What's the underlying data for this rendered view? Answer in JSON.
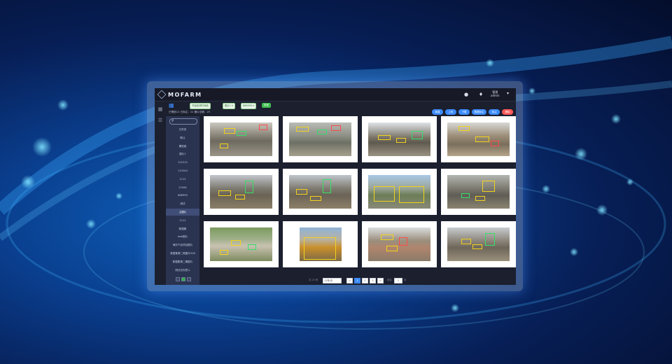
{
  "app": {
    "logo_text": "MOFARM",
    "user": {
      "name": "管理",
      "role": "admin"
    }
  },
  "rail": {
    "icons": [
      "grid-icon",
      "list-icon"
    ]
  },
  "sidebar": {
    "items": [
      "文件夹",
      "默认",
      "模型组",
      "图片1",
      "121212",
      "112244",
      "1111",
      "22444",
      "888990",
      "测试",
      "主图片",
      "1111",
      "数据集",
      "web图片",
      "海外产品项目图片",
      "数据集第二期图片528",
      "数据集第二期图片",
      "测试无标签人"
    ],
    "active_index": 10
  },
  "toolbar": {
    "chips": [
      "开始检测时间段",
      "图片1 ▾",
      "888990 ▾"
    ],
    "search_label": "检索",
    "filter_text": "已筛选12 已标注：22 图片总数：25",
    "buttons": [
      {
        "label": "新建",
        "color": "#3d8cff"
      },
      {
        "label": "上传",
        "color": "#3d8cff"
      },
      {
        "label": "下载",
        "color": "#3d8cff"
      },
      {
        "label": "数据标注",
        "color": "#3d8cff"
      },
      {
        "label": "标注",
        "color": "#3d8cff"
      },
      {
        "label": "删除",
        "color": "#ff5a5a"
      }
    ]
  },
  "pagination": {
    "total_label": "共 25 条",
    "page_size": "12条/页",
    "pages": [
      "<",
      "1",
      "2",
      "3",
      ">"
    ],
    "current_page": "1",
    "goto_label": "前往",
    "goto_value": "1",
    "page_suffix": "页"
  }
}
